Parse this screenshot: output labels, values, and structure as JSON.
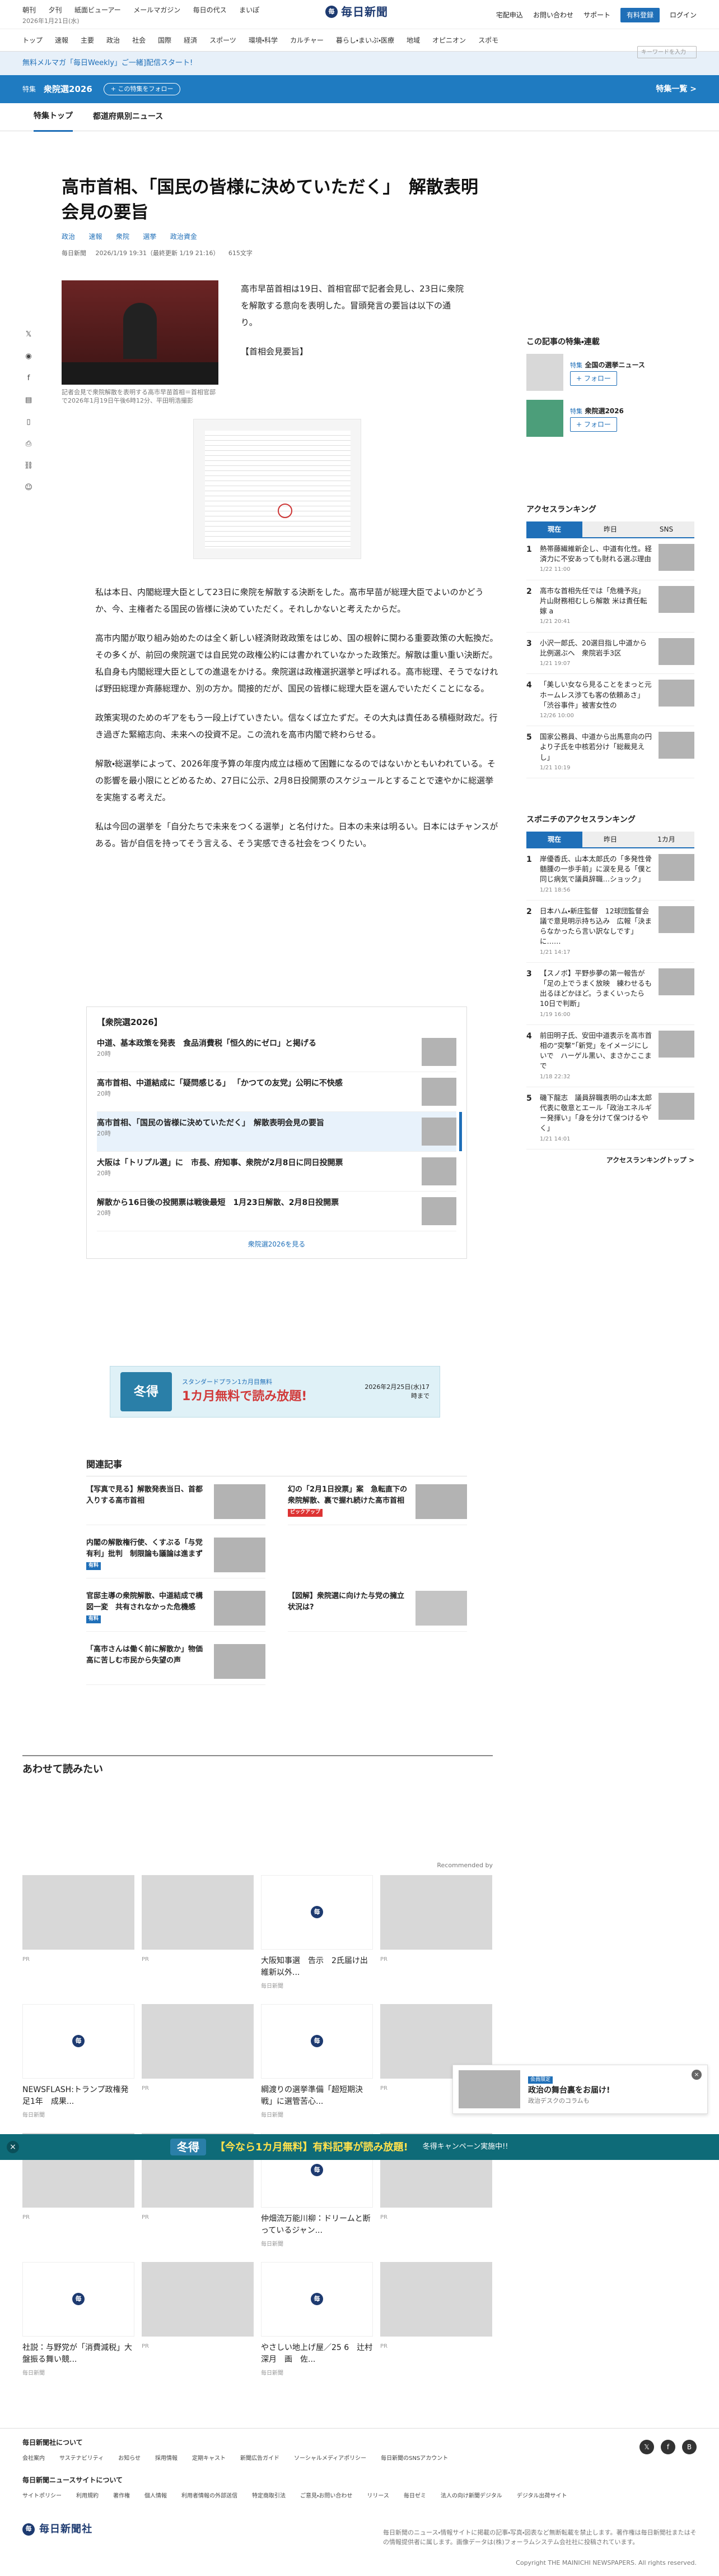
{
  "header": {
    "date": "2026年1月21日(水)",
    "left_links": [
      "朝刊",
      "夕刊",
      "紙面ビューアー",
      "メールマガジン",
      "毎日の代ス",
      "まいぽ"
    ],
    "logo_text": "毎日新聞",
    "right_links": [
      "宅配申込",
      "お問い合わせ",
      "サポート"
    ],
    "register": "有料登録",
    "login": "ログイン"
  },
  "categories": [
    "トップ",
    "速報",
    "主要",
    "政治",
    "社会",
    "国際",
    "経済",
    "スポーツ",
    "環境・科学",
    "カルチャー",
    "暮らし・まいぷ・医療",
    "地域",
    "オピニオン",
    "スポモ"
  ],
  "search_placeholder": "キーワードを入力",
  "promo": "無料メルマガ「毎日Weekly」ご一緒]配信スタート!",
  "feature": {
    "chip": "特集",
    "title": "衆院選2026",
    "follow": "+ この特集をフォロー",
    "more": "特集一覧 >"
  },
  "subnav": [
    "特集トップ",
    "都道府県別ニュース"
  ],
  "article": {
    "title": "高市首相、「国民の皆様に決めていただく」　解散表明会見の要旨",
    "tags": [
      "政治",
      "速報",
      "衆院",
      "選挙",
      "政治資金"
    ],
    "meta": [
      "毎日新聞",
      "2026/1/19 19:31（最終更新 1/19 21:16）",
      "615文字"
    ],
    "lead": "高市早苗首相は19日、首相官邸で記者会見し、23日に衆院を解散する意向を表明した。冒頭発言の要旨は以下の通り。",
    "section": "【首相会見要旨】",
    "caption": "記者会見で衆院解散を表明する高市早苗首相＝首相官邸で2026年1月19日午後6時12分、平田明浩撮影",
    "paragraphs": [
      "私は本日、内閣総理大臣として23日に衆院を解散する決断をした。高市早苗が総理大臣でよいのかどうか、今、主権者たる国民の皆様に決めていただく。それしかないと考えたからだ。",
      "高市内閣が取り組み始めたのは全く新しい経済財政政策をはじめ、国の根幹に関わる重要政策の大転換だ。その多くが、前回の衆院選では自民党の政権公約には書かれていなかった政策だ。解散は重い重い決断だ。私自身も内閣総理大臣としての進退をかける。衆院選は政権選択選挙と呼ばれる。高市総理、そうでなければ野田総理か斉藤総理か、別の方か。間接的だが、国民の皆様に総理大臣を選んでいただくことになる。",
      "政策実現のためのギアをもう一段上げていきたい。信なくば立たずだ。その大丸は責任ある積極財政だ。行き過ぎた緊縮志向、未来への投資不足。この流れを高市内閣で終わらせる。",
      "解散・総選挙によって、2026年度予算の年度内成立は極めて困難になるのではないかともいわれている。その影響を最小限にとどめるため、27日に公示、2月8日投開票のスケジュールとすることで速やかに総選挙を実施する考えだ。",
      "私は今回の選挙を「自分たちで未来をつくる選挙」と名付けた。日本の未来は明るい。日本にはチャンスがある。皆が自信を持ってそう言える、そう実感できる社会をつくりたい。"
    ]
  },
  "election_box": {
    "title": "【衆院選2026】",
    "items": [
      {
        "title": "中道、基本政策を発表　食品消費税「恒久的にゼロ」と掲げる",
        "date": "20時"
      },
      {
        "title": "高市首相、中道結成に「疑問感じる」 「かつての友党」公明に不快感",
        "date": "20時"
      },
      {
        "title": "高市首相、「国民の皆様に決めていただく」　解散表明会見の要旨",
        "date": "20時"
      },
      {
        "title": "大阪は「トリプル選」に　市長、府知事、衆院が2月8日に同日投開票",
        "date": "20時"
      },
      {
        "title": "解散から16日後の投開票は戦後最短　1月23日解散、2月8日投開票",
        "date": "20時"
      }
    ],
    "more": "衆院選2026を見る"
  },
  "banner": {
    "season": "冬得",
    "line1": "スタンダードプラン1カ月目無料",
    "line2": "1カ月無料で読み放題!",
    "date": "2026年2月25日(水)17時まで"
  },
  "related": {
    "title": "関連記事",
    "items": [
      {
        "title": "【写真で見る】解散発表当日、首都入りする高市首相",
        "badge": ""
      },
      {
        "title": "幻の「2月1日投票」案　急転直下の衆院解散、裏で握れ続けた高市首相",
        "badge": "ピックアップ"
      },
      {
        "title": "内閣の解散権行使、くすぶる「与党有利」批判　制限論も議論は進まず",
        "badge": "有料"
      },
      {
        "title": "",
        "badge": ""
      },
      {
        "title": "官邸主導の衆院解散、中道結成で構図一変　共有されなかった危機感",
        "badge": "有料"
      },
      {
        "title": "【図解】衆院選に向けた与党の擁立状況は?",
        "badge": ""
      },
      {
        "title": "「高市さんは働く前に解散か」物価高に苦しむ市民から失望の声",
        "badge": ""
      }
    ]
  },
  "readmore": {
    "title": "あわせて読みたい",
    "recommended": "Recommended by",
    "cards": [
      {
        "title": "",
        "sub": "PR"
      },
      {
        "title": "",
        "sub": "PR"
      },
      {
        "title": "大阪知事選　告示　2氏届け出　維新以外...",
        "sub": "毎日新聞"
      },
      {
        "title": "",
        "sub": "PR"
      },
      {
        "title": "NEWSFLASH:トランプ政権発足1年　成果...",
        "sub": "毎日新聞"
      },
      {
        "title": "",
        "sub": "PR"
      },
      {
        "title": "綱渡りの選挙準備「超短期決戦」に選管苦心...",
        "sub": "毎日新聞"
      },
      {
        "title": "",
        "sub": "PR"
      },
      {
        "title": "",
        "sub": "PR"
      },
      {
        "title": "",
        "sub": "PR"
      },
      {
        "title": "仲畑流万能川柳：ドリームと断っているジャン...",
        "sub": "毎日新聞"
      },
      {
        "title": "",
        "sub": "PR"
      },
      {
        "title": "社説：与野党が「消費減税」大盤振る舞い競...",
        "sub": "毎日新聞"
      },
      {
        "title": "",
        "sub": "PR"
      },
      {
        "title": "やさしい地上げ屋／25 6　辻村深月　画　佐...",
        "sub": "毎日新聞"
      },
      {
        "title": "",
        "sub": "PR"
      }
    ]
  },
  "sidebar": {
    "follow_title": "この記事の特集・連載",
    "follow_items": [
      {
        "chip": "特集",
        "title": "全国の選挙ニュース",
        "btn": "+ フォロー"
      },
      {
        "chip": "特集",
        "title": "衆院選2026",
        "btn": "+ フォロー"
      }
    ],
    "ranking_title": "アクセスランキング",
    "ranking_tabs": [
      "現在",
      "昨日",
      "SNS"
    ],
    "ranking": [
      {
        "t": "熱帯藤繊維新企し、中道有化性。経済力に不安あっても財れる選ぶ理由",
        "d": "1/22 11:00"
      },
      {
        "t": "高市な首相先任では「危機予兆」 片山財務相むしら解散 米は責任転嫁 a",
        "d": "1/21 20:41"
      },
      {
        "t": "小沢一郎氏、20選目指し中道から比例選ぶへ　衆院岩手3区",
        "d": "1/21 19:07"
      },
      {
        "t": "「美しい女なら見ることをまっと元ホームレス渉ても客の依頼あさ」 「渋谷事件」被害女性の",
        "d": "12/26 10:00"
      },
      {
        "t": "国家公務員、中道から出馬意向の円より子氏を中核若分け「総裁見えし」",
        "d": "1/21 10:19"
      }
    ],
    "sports_title": "スポニチのアクセスランキング",
    "sports_tabs": [
      "現在",
      "昨日",
      "1カ月"
    ],
    "sports": [
      {
        "t": "岸優香氏、山本太郎氏の「多発性骨髄腫の一歩手前」に涙を見る「僕と同じ病気で議員辞職…ショック」",
        "d": "1/21 18:56"
      },
      {
        "t": "日本ハム・新庄監督　12球団監督会議で意見明示持ち込み　広報「決まらなかったら言い訳なしです」に……",
        "d": "1/21 14:17"
      },
      {
        "t": "【スノボ】平野歩夢の第一報告が「足の上でうまく放映　練わせるも出るほどかほど。うまくいったら10日で判断」",
        "d": "1/19 16:00"
      },
      {
        "t": "前田明子氏、安田中道表示を高市首相の“突撃”「新党」をイメージにしいで　ハーゲル黒い、まさかここまで",
        "d": "1/18 22:32"
      },
      {
        "t": "磯下龍志　議員辞職表明の山本太郎代表に敬意とエール「政治エネルギー発揮い」「身を分けて保つけるやく」",
        "d": "1/21 14:01"
      }
    ],
    "sports_more": "アクセスランキングトップ >"
  },
  "campaign": {
    "season": "冬得",
    "text": "【今なら1カ月無料】有料記事が読み放題!",
    "sub": "冬得キャンペーン実施中!!"
  },
  "popup": {
    "tag": "会員限定",
    "title": "政治の舞台裏をお届け!",
    "sub": "政治デスクのコラムも"
  },
  "footer": {
    "about_title": "毎日新聞社について",
    "about": [
      "会社案内",
      "サステナビリティ",
      "お知らせ",
      "採用情報",
      "定期キャスト",
      "新聞広告ガイド",
      "ソーシャルメディアポリシー",
      "毎日新聞のSNSアカウント"
    ],
    "site_title": "毎日新聞ニュースサイトについて",
    "site": [
      "サイトポリシー",
      "利用規約",
      "著作権",
      "個人情報",
      "利用者情報の外部送信",
      "特定商取引法",
      "ご意見・お問い合わせ",
      "リリース",
      "毎日ゼミ",
      "法人の向け新聞デジタル",
      "デジタル出荷サイト"
    ],
    "company": "毎日新聞社",
    "note": "毎日新聞のニュース・情報サイトに掲載の記事・写真・図表など無断転載を禁止します。著作権は毎日新聞社またはその情報提供者に属します。画像データは(株)フォーラムシステム会社社に投稿されています。",
    "copyright": "Copyright THE MAINICHI NEWSPAPERS. All rights reserved."
  }
}
